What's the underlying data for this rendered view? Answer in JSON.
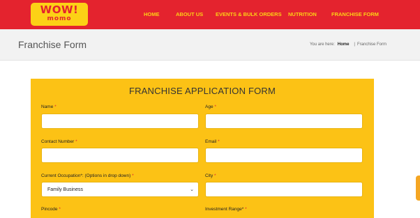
{
  "header": {
    "logo_top": "WOW!",
    "logo_bottom": "momo",
    "nav": [
      "HOME",
      "ABOUT US",
      "EVENTS & BULK ORDERS",
      "NUTRITION",
      "FRANCHISE FORM"
    ]
  },
  "titlebar": {
    "title": "Franchise Form",
    "crumb_prefix": "You are here:",
    "crumb_home": "Home",
    "crumb_sep": "|",
    "crumb_current": "Franchise Form"
  },
  "form": {
    "title": "FRANCHISE APPLICATION FORM",
    "required_mark": "*",
    "labels": {
      "name": "Name",
      "age": "Age",
      "contact": "Contact Number",
      "email": "Email",
      "occupation": "Current Occupation*: (Options in drop down)",
      "city": "City",
      "pincode": "Pincode",
      "investment": "Investment Range*"
    },
    "values": {
      "name": "",
      "age": "",
      "contact": "",
      "email": "",
      "occupation": "Family Business",
      "city": ""
    }
  },
  "colors": {
    "header_red": "#e4232e",
    "brand_yellow": "#fcd116",
    "panel_yellow": "#fcc215"
  }
}
